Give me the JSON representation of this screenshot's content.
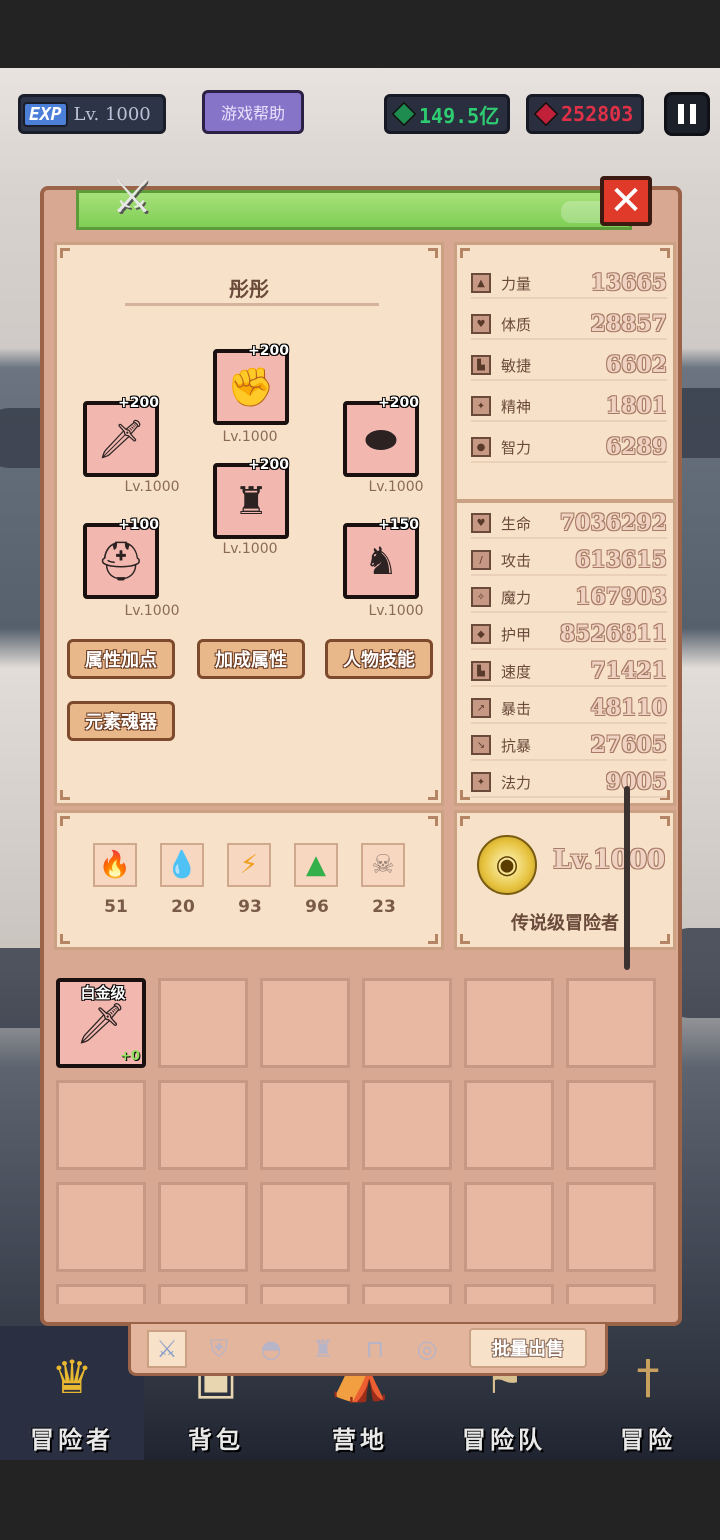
{
  "topbar": {
    "exp_label": "EXP",
    "level": "Lv. 1000",
    "help_button": "游戏帮助",
    "green_currency": "149.5亿",
    "red_currency": "252803"
  },
  "hero": {
    "name": "彤彤",
    "equipment": [
      {
        "icon": "gauntlet-icon",
        "glyph": "✊",
        "plus": "+200",
        "level": "Lv.1000"
      },
      {
        "icon": "sword-icon",
        "glyph": "🗡",
        "plus": "+200",
        "level": "Lv.1000"
      },
      {
        "icon": "shield-icon",
        "glyph": "⬬",
        "plus": "+200",
        "level": "Lv.1000"
      },
      {
        "icon": "armor-icon",
        "glyph": "♜",
        "plus": "+200",
        "level": "Lv.1000"
      },
      {
        "icon": "helmet-icon",
        "glyph": "⛑",
        "plus": "+100",
        "level": "Lv.1000"
      },
      {
        "icon": "boots-icon",
        "glyph": "♞",
        "plus": "+150",
        "level": "Lv.1000"
      }
    ],
    "buttons": {
      "attr_points": "属性加点",
      "bonus_attr": "加成属性",
      "skills": "人物技能",
      "element_soul": "元素魂器"
    }
  },
  "base_attrs": [
    {
      "label": "力量",
      "value": "13665"
    },
    {
      "label": "体质",
      "value": "28857"
    },
    {
      "label": "敏捷",
      "value": "6602"
    },
    {
      "label": "精神",
      "value": "1801"
    },
    {
      "label": "智力",
      "value": "6289"
    }
  ],
  "combat_attrs": [
    {
      "label": "生命",
      "value": "7036292"
    },
    {
      "label": "攻击",
      "value": "613615"
    },
    {
      "label": "魔力",
      "value": "167903"
    },
    {
      "label": "护甲",
      "value": "8526811"
    },
    {
      "label": "速度",
      "value": "71421"
    },
    {
      "label": "暴击",
      "value": "48110"
    },
    {
      "label": "抗暴",
      "value": "27605"
    },
    {
      "label": "法力",
      "value": "9005"
    }
  ],
  "elements": [
    {
      "icon": "fire-icon",
      "glyph": "🔥",
      "count": "51",
      "color": "#e8471f"
    },
    {
      "icon": "water-icon",
      "glyph": "💧",
      "count": "20",
      "color": "#3ba0e0"
    },
    {
      "icon": "lightning-icon",
      "glyph": "⚡",
      "count": "93",
      "color": "#f0a020"
    },
    {
      "icon": "earth-icon",
      "glyph": "▲",
      "count": "96",
      "color": "#33b04a"
    },
    {
      "icon": "skull-icon",
      "glyph": "☠",
      "count": "23",
      "color": "#9a8478"
    }
  ],
  "rank": {
    "level": "Lv.1000",
    "title": "传说级冒险者"
  },
  "inventory": {
    "item": {
      "tier": "白金级",
      "enhance": "+0"
    }
  },
  "tabs": {
    "bulk_sell": "批量出售"
  },
  "nav": [
    {
      "label": "冒险者"
    },
    {
      "label": "背包"
    },
    {
      "label": "营地"
    },
    {
      "label": "冒险队"
    },
    {
      "label": "冒险"
    }
  ],
  "colors": {
    "panel": "#d9a892",
    "sub_panel": "#f7e2c9",
    "title_bar": "#8fd765",
    "close": "#e03a2a"
  }
}
